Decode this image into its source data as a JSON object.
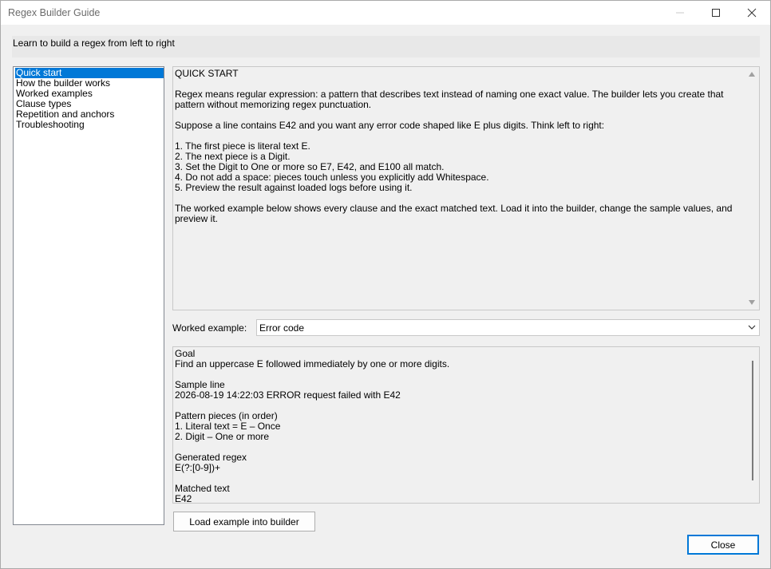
{
  "window": {
    "title": "Regex Builder Guide"
  },
  "header": {
    "text": "Learn to build a regex from left to right"
  },
  "nav": {
    "items": [
      {
        "label": "Quick start",
        "selected": true
      },
      {
        "label": "How the builder works",
        "selected": false
      },
      {
        "label": "Worked examples",
        "selected": false
      },
      {
        "label": "Clause types",
        "selected": false
      },
      {
        "label": "Repetition and anchors",
        "selected": false
      },
      {
        "label": "Troubleshooting",
        "selected": false
      }
    ]
  },
  "guide": {
    "lines": [
      "QUICK START",
      "",
      "Regex means regular expression: a pattern that describes text instead of naming one exact value. The builder lets you create that pattern without memorizing regex punctuation.",
      "",
      "Suppose a line contains E42 and you want any error code shaped like E plus digits. Think left to right:",
      "",
      "1. The first piece is literal text E.",
      "2. The next piece is a Digit.",
      "3. Set the Digit to One or more so E7, E42, and E100 all match.",
      "4. Do not add a space: pieces touch unless you explicitly add Whitespace.",
      "5. Preview the result against loaded logs before using it.",
      "",
      "The worked example below shows every clause and the exact matched text. Load it into the builder, change the sample values, and preview it."
    ]
  },
  "example": {
    "label": "Worked example:",
    "selected": "Error code"
  },
  "detail": {
    "lines": [
      "Goal",
      "Find an uppercase E followed immediately by one or more digits.",
      "",
      "Sample line",
      "2026-08-19 14:22:03 ERROR request failed with E42",
      "",
      "Pattern pieces (in order)",
      "1. Literal text = E – Once",
      "2. Digit – One or more",
      "",
      "Generated regex",
      "E(?:[0-9])+",
      "",
      "Matched text",
      "E42"
    ]
  },
  "buttons": {
    "load": "Load example into builder",
    "close": "Close"
  },
  "colors": {
    "selection": "#0078d7",
    "background": "#f0f0f0"
  }
}
